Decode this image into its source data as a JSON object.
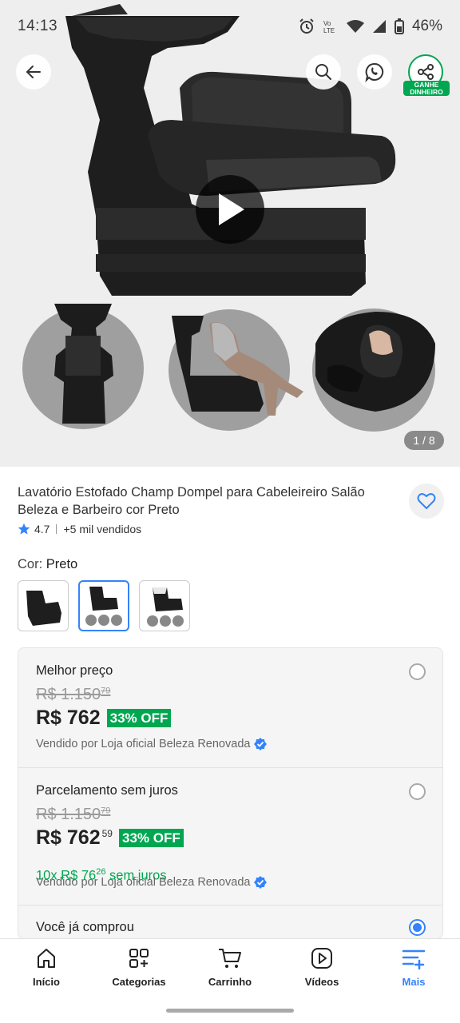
{
  "status_bar": {
    "time": "14:13",
    "battery": "46%",
    "icons": [
      "alarm-icon",
      "volte-icon",
      "wifi-icon",
      "signal-icon",
      "battery-icon"
    ]
  },
  "gallery": {
    "page_counter": "1 / 8",
    "share_badge": "GANHE DINHEIRO"
  },
  "product": {
    "title": "Lavatório Estofado Champ Dompel para Cabeleireiro Salão Beleza e Barbeiro cor Preto",
    "rating": "4.7",
    "sold": "+5 mil vendidos",
    "color_label": "Cor: ",
    "color_value": "Preto",
    "swatch_selected_index": 1
  },
  "offers": [
    {
      "title": "Melhor preço",
      "old_price": "R$ 1.150",
      "old_cents": "79",
      "price": "R$ 762",
      "price_cents": "",
      "discount": "33% OFF",
      "seller": "Vendido por Loja oficial Beleza Renovada",
      "selected": false
    },
    {
      "title": "Parcelamento sem juros",
      "old_price": "R$ 1.150",
      "old_cents": "79",
      "price": "R$ 762",
      "price_cents": "59",
      "discount": "33% OFF",
      "installments_prefix": "10x R$ 76",
      "installments_cents": "26",
      "installments_suffix": " sem juros",
      "seller": "Vendido por Loja oficial Beleza Renovada",
      "selected": false
    },
    {
      "title": "Você já comprou",
      "selected": true
    }
  ],
  "bottom_nav": [
    {
      "label": "Início",
      "icon": "home-icon"
    },
    {
      "label": "Categorias",
      "icon": "categories-icon"
    },
    {
      "label": "Carrinho",
      "icon": "cart-icon"
    },
    {
      "label": "Vídeos",
      "icon": "video-icon"
    },
    {
      "label": "Mais",
      "icon": "menu-plus-icon",
      "active": true
    }
  ],
  "colors": {
    "accent": "#3483fa",
    "green": "#00a650"
  }
}
